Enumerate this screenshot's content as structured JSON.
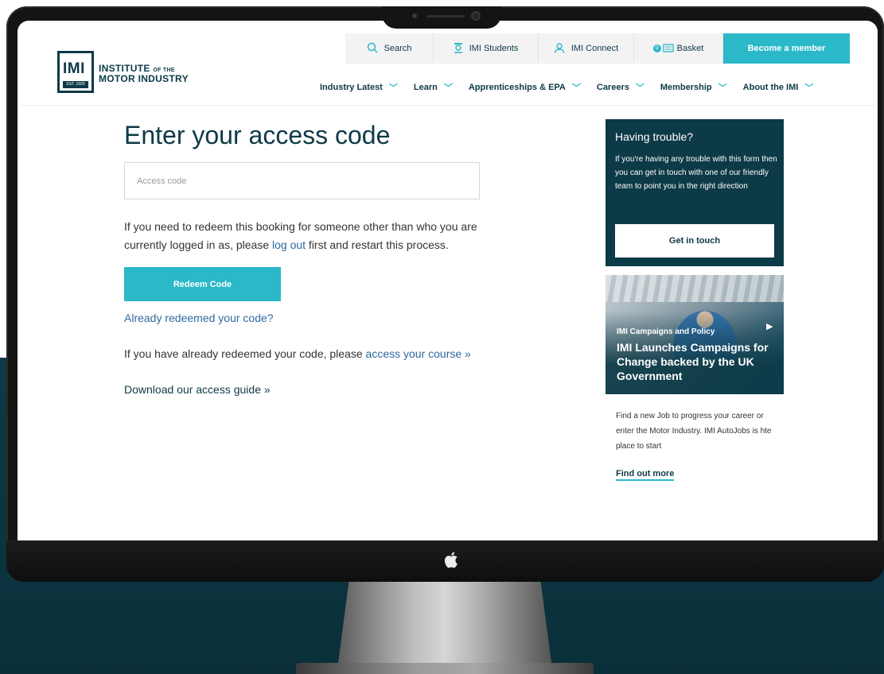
{
  "header": {
    "logo": {
      "mark": "IMI",
      "line1": "INSTITUTE",
      "line1_small": "OF THE",
      "line2": "MOTOR INDUSTRY",
      "est": "EST. 1920"
    },
    "topbar": [
      {
        "label": "Search",
        "icon": "search-icon"
      },
      {
        "label": "IMI Students",
        "icon": "student-icon"
      },
      {
        "label": "IMI Connect",
        "icon": "person-icon"
      },
      {
        "label": "Basket",
        "icon": "basket-icon",
        "badge": "0"
      },
      {
        "label": "Become a member"
      }
    ],
    "nav": [
      "Industry Latest",
      "Learn",
      "Apprenticeships & EPA",
      "Careers",
      "Membership",
      "About the IMI"
    ]
  },
  "main": {
    "title": "Enter your access code",
    "input_placeholder": "Access code",
    "para1_before": "If you need to redeem this booking for someone other than who you are currently logged in as, please ",
    "para1_link": "log out",
    "para1_after": " first and restart this process.",
    "redeem_label": "Redeem Code",
    "already_link": "Already redeemed your code?",
    "para2_before": "If you have already redeemed your code, please ",
    "para2_link": "access your course »",
    "download_link": "Download our access guide »"
  },
  "sidebar": {
    "trouble_title": "Having trouble?",
    "trouble_text": "If you're having any trouble with this form then you can get in touch with one of our friendly team to point you in the right direction",
    "touch_label": "Get in touch",
    "campaign_tag": "IMI Campaigns and Policy",
    "campaign_title": "IMI Launches Campaigns for Change backed by the UK Government",
    "jobs_text": "Find a new Job to progress your career or enter the Motor Industry. IMI AutoJobs is hte place to start",
    "find_out": "Find out more"
  },
  "colors": {
    "dark_teal": "#0d3a47",
    "accent": "#2bb8c9",
    "link": "#2d6a9f"
  }
}
